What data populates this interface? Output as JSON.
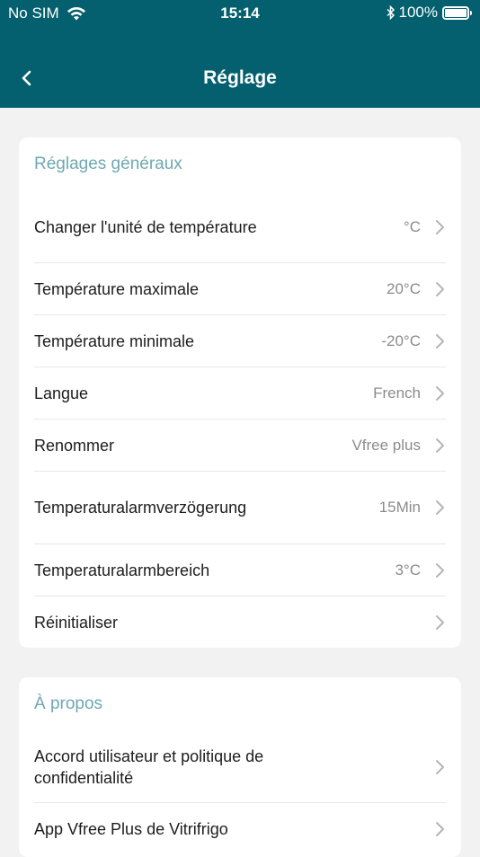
{
  "status_bar": {
    "carrier": "No SIM",
    "time": "15:14",
    "battery": "100%"
  },
  "nav": {
    "title": "Réglage"
  },
  "general": {
    "title": "Réglages généraux",
    "items": [
      {
        "label": "Changer l'unité de température",
        "value": "°C"
      },
      {
        "label": "Température maximale",
        "value": "20°C"
      },
      {
        "label": "Température minimale",
        "value": "-20°C"
      },
      {
        "label": "Langue",
        "value": "French"
      },
      {
        "label": "Renommer",
        "value": "Vfree plus"
      },
      {
        "label": "Temperaturalarmverzögerung",
        "value": "15Min"
      },
      {
        "label": "Temperaturalarmbereich",
        "value": "3°C"
      },
      {
        "label": "Réinitialiser",
        "value": ""
      }
    ]
  },
  "about": {
    "title": "À propos",
    "items": [
      {
        "label": "Accord utilisateur et politique de confidentialité"
      },
      {
        "label": "App Vfree Plus de Vitrifrigo"
      }
    ]
  },
  "colors": {
    "header": "#045f6e",
    "section_title": "#6fa8b2",
    "background": "#f2f2f2"
  }
}
